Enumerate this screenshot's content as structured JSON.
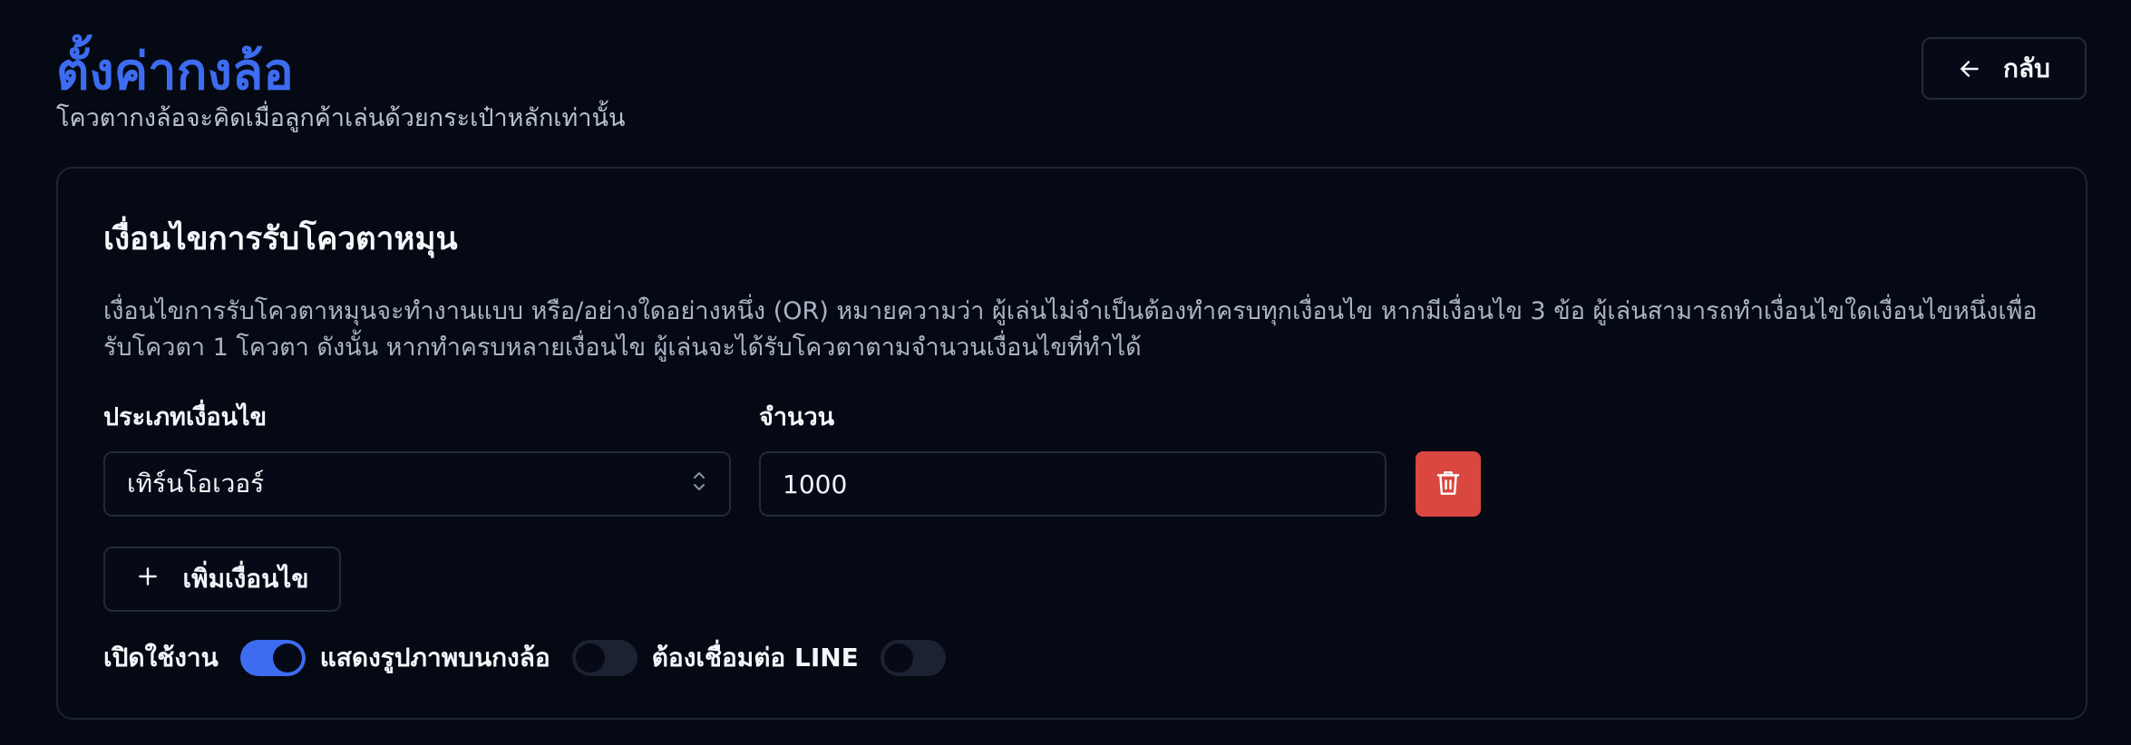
{
  "header": {
    "title": "ตั้งค่ากงล้อ",
    "subtitle": "โควตากงล้อจะคิดเมื่อลูกค้าเล่นด้วยกระเป๋าหลักเท่านั้น",
    "back_label": "กลับ"
  },
  "card": {
    "title": "เงื่อนไขการรับโควตาหมุน",
    "description": "เงื่อนไขการรับโควตาหมุนจะทำงานแบบ หรือ/อย่างใดอย่างหนึ่ง (OR) หมายความว่า ผู้เล่นไม่จำเป็นต้องทำครบทุกเงื่อนไข หากมีเงื่อนไข 3 ข้อ ผู้เล่นสามารถทำเงื่อนไขใดเงื่อนไขหนึ่งเพื่อรับโควตา 1 โควตา ดังนั้น หากทำครบหลายเงื่อนไข ผู้เล่นจะได้รับโควตาตามจำนวนเงื่อนไขที่ทำได้",
    "condition": {
      "type_label": "ประเภทเงื่อนไข",
      "type_value": "เทิร์นโอเวอร์",
      "amount_label": "จำนวน",
      "amount_value": "1000"
    },
    "add_condition_label": "เพิ่มเงื่อนไข",
    "toggles": [
      {
        "label": "เปิดใช้งาน",
        "on": true
      },
      {
        "label": "แสดงรูปภาพบนกงล้อ",
        "on": false
      },
      {
        "label": "ต้องเชื่อมต่อ LINE",
        "on": false
      }
    ]
  },
  "colors": {
    "accent": "#3d6cf0",
    "danger": "#d9473f",
    "background": "#050914"
  },
  "icons": {
    "back": "arrow-left-icon",
    "select": "chevron-up-down-icon",
    "delete": "trash-icon",
    "add": "plus-icon"
  }
}
